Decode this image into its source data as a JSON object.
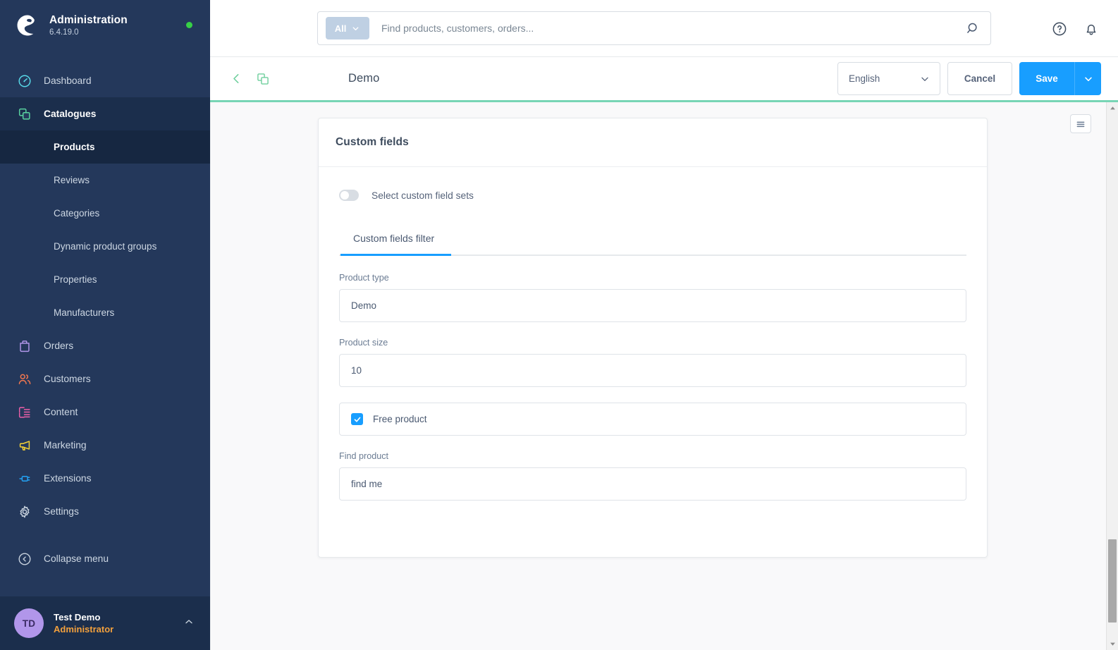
{
  "sidebar": {
    "brand": {
      "title": "Administration",
      "version": "6.4.19.0",
      "status_color": "#37d046"
    },
    "items": [
      {
        "label": "Dashboard",
        "icon": "dashboard-gauge-icon",
        "color": "#57d9e8",
        "active": false,
        "sub": false
      },
      {
        "label": "Catalogues",
        "icon": "catalogues-stacked-squares-icon",
        "color": "#5ad3a0",
        "active": true,
        "sub": false
      },
      {
        "label": "Products",
        "icon": "",
        "color": "",
        "active": true,
        "sub": true
      },
      {
        "label": "Reviews",
        "icon": "",
        "color": "",
        "active": false,
        "sub": true
      },
      {
        "label": "Categories",
        "icon": "",
        "color": "",
        "active": false,
        "sub": true
      },
      {
        "label": "Dynamic product groups",
        "icon": "",
        "color": "",
        "active": false,
        "sub": true
      },
      {
        "label": "Properties",
        "icon": "",
        "color": "",
        "active": false,
        "sub": true
      },
      {
        "label": "Manufacturers",
        "icon": "",
        "color": "",
        "active": false,
        "sub": true
      },
      {
        "label": "Orders",
        "icon": "orders-bag-icon",
        "color": "#b196ea",
        "active": false,
        "sub": false
      },
      {
        "label": "Customers",
        "icon": "customers-people-icon",
        "color": "#f2774f",
        "active": false,
        "sub": false
      },
      {
        "label": "Content",
        "icon": "content-layout-icon",
        "color": "#ed5fa8",
        "active": false,
        "sub": false
      },
      {
        "label": "Marketing",
        "icon": "marketing-megaphone-icon",
        "color": "#f7d335",
        "active": false,
        "sub": false
      },
      {
        "label": "Extensions",
        "icon": "extensions-plug-icon",
        "color": "#23a3f5",
        "active": false,
        "sub": false
      },
      {
        "label": "Settings",
        "icon": "settings-gear-icon",
        "color": "#c8d2de",
        "active": false,
        "sub": false
      }
    ],
    "collapse": {
      "label": "Collapse menu",
      "icon": "collapse-left-circle-icon"
    },
    "user": {
      "initials": "TD",
      "name": "Test Demo",
      "role": "Administrator",
      "avatar_color": "#b196ea",
      "role_color": "#f2a03d"
    }
  },
  "topbar": {
    "search": {
      "scope_label": "All",
      "placeholder": "Find products, customers, orders...",
      "value": ""
    },
    "help_icon": "help-question-circle-icon",
    "notification_icon": "notification-bell-icon"
  },
  "smartbar": {
    "back_icon": "chevron-left-icon",
    "duplicate_icon": "duplicate-squares-icon",
    "title": "Demo",
    "language": {
      "value": "English",
      "caret_icon": "chevron-down-icon"
    },
    "cancel_label": "Cancel",
    "save_label": "Save",
    "save_caret_icon": "chevron-down-icon",
    "accent_color": "#189eff",
    "progress_color": "#78d5b5"
  },
  "content": {
    "side_toggle_icon": "hamburger-menu-icon",
    "card": {
      "title": "Custom fields",
      "toggle": {
        "label": "Select custom field sets",
        "checked": false
      },
      "tabs": [
        {
          "label": "Custom fields filter",
          "active": true
        }
      ],
      "fields": [
        {
          "type": "text",
          "name": "product-type",
          "label": "Product type",
          "value": "Demo"
        },
        {
          "type": "text",
          "name": "product-size",
          "label": "Product size",
          "value": "10"
        },
        {
          "type": "checkbox",
          "name": "free-product",
          "label": "Free product",
          "checked": true
        },
        {
          "type": "text",
          "name": "find-product",
          "label": "Find product",
          "value": "find me"
        }
      ]
    }
  },
  "scrollbar": {
    "up_icon": "scroll-up-arrow-icon",
    "down_icon": "scroll-down-arrow-icon"
  }
}
